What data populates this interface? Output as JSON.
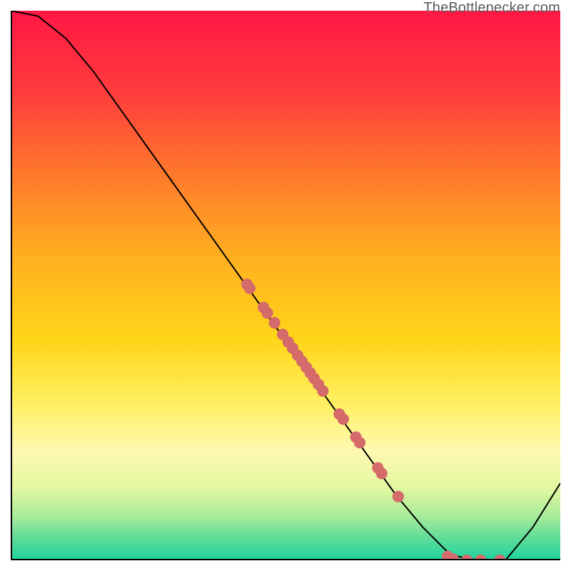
{
  "watermark": "TheBottlenecker.com",
  "chart_data": {
    "type": "line",
    "title": "",
    "xlabel": "",
    "ylabel": "",
    "xlim": [
      0,
      100
    ],
    "ylim": [
      0,
      100
    ],
    "x": [
      0,
      5,
      10,
      15,
      20,
      25,
      30,
      35,
      40,
      45,
      50,
      55,
      60,
      65,
      70,
      75,
      80,
      85,
      90,
      95,
      100
    ],
    "values": [
      100,
      99,
      95,
      89,
      82,
      75,
      68,
      61,
      54,
      47,
      40,
      33,
      26,
      19,
      12,
      6,
      1,
      0,
      0,
      6,
      14
    ],
    "gradient_stops": [
      {
        "pos": 0.0,
        "color": "#ff1744"
      },
      {
        "pos": 0.15,
        "color": "#ff3d3d"
      },
      {
        "pos": 0.3,
        "color": "#ff7a2a"
      },
      {
        "pos": 0.45,
        "color": "#ffb020"
      },
      {
        "pos": 0.6,
        "color": "#ffd618"
      },
      {
        "pos": 0.72,
        "color": "#fff166"
      },
      {
        "pos": 0.8,
        "color": "#fff9b0"
      },
      {
        "pos": 0.87,
        "color": "#e1f7a0"
      },
      {
        "pos": 0.92,
        "color": "#a8ec9a"
      },
      {
        "pos": 0.96,
        "color": "#5edc98"
      },
      {
        "pos": 1.0,
        "color": "#1fd3a0"
      }
    ],
    "scatter_points": [
      {
        "x": 43.0,
        "y": 50.2
      },
      {
        "x": 43.5,
        "y": 49.5
      },
      {
        "x": 46.0,
        "y": 46.0
      },
      {
        "x": 46.7,
        "y": 45.0
      },
      {
        "x": 48.0,
        "y": 43.2
      },
      {
        "x": 49.5,
        "y": 41.1
      },
      {
        "x": 50.5,
        "y": 39.7
      },
      {
        "x": 51.3,
        "y": 38.6
      },
      {
        "x": 52.2,
        "y": 37.3
      },
      {
        "x": 53.0,
        "y": 36.2
      },
      {
        "x": 53.8,
        "y": 35.1
      },
      {
        "x": 54.5,
        "y": 34.1
      },
      {
        "x": 55.2,
        "y": 33.1
      },
      {
        "x": 56.0,
        "y": 32.0
      },
      {
        "x": 56.8,
        "y": 30.8
      },
      {
        "x": 59.8,
        "y": 26.6
      },
      {
        "x": 60.5,
        "y": 25.7
      },
      {
        "x": 62.8,
        "y": 22.4
      },
      {
        "x": 63.5,
        "y": 21.4
      },
      {
        "x": 66.8,
        "y": 16.8
      },
      {
        "x": 67.5,
        "y": 15.8
      },
      {
        "x": 70.5,
        "y": 11.6
      },
      {
        "x": 79.5,
        "y": 0.7
      },
      {
        "x": 80.5,
        "y": 0.2
      },
      {
        "x": 83.0,
        "y": 0.0
      },
      {
        "x": 85.5,
        "y": 0.0
      },
      {
        "x": 89.0,
        "y": 0.0
      }
    ],
    "scatter_color": "#d46a6a",
    "line_color": "#000000"
  }
}
